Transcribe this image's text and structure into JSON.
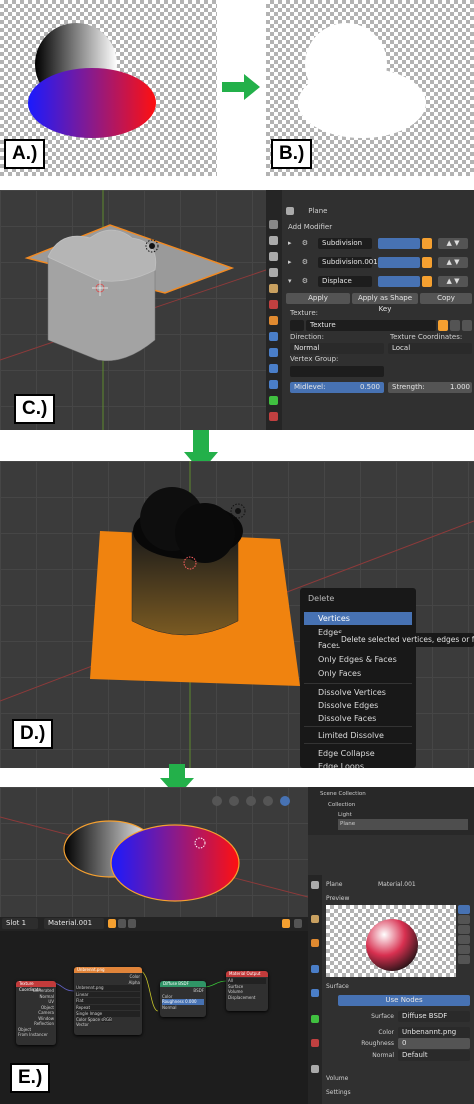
{
  "labels": {
    "a": "A.)",
    "b": "B.)",
    "c": "C.)",
    "d": "D.)",
    "e": "E.)"
  },
  "colors": {
    "arrow": "#23b04a",
    "blender_bg": "#303030",
    "select_orange": "#f5a030",
    "highlight_blue": "#4772b3",
    "node_image": "#e0843a",
    "node_mapping": "#2f9466",
    "node_output": "#c23b3b"
  },
  "modifier_panel": {
    "object_name": "Plane",
    "add_modifier": "Add Modifier",
    "modifiers": [
      "Subdivision",
      "Subdivision.001",
      "Displace"
    ],
    "apply": "Apply",
    "apply_shape": "Apply as Shape Key",
    "copy": "Copy",
    "texture_label": "Texture:",
    "texture_value": "Texture",
    "direction_label": "Direction:",
    "direction_value": "Normal",
    "coords_label": "Texture Coordinates:",
    "coords_value": "Local",
    "vgroup_label": "Vertex Group:",
    "midlevel_label": "Midlevel:",
    "midlevel_value": "0.500",
    "strength_label": "Strength:",
    "strength_value": "1.000"
  },
  "delete_menu": {
    "title": "Delete",
    "items": [
      "Vertices",
      "Edges",
      "Faces",
      "Only Edges & Faces",
      "Only Faces",
      "Dissolve Vertices",
      "Dissolve Edges",
      "Dissolve Faces",
      "Limited Dissolve",
      "Edge Collapse",
      "Edge Loops"
    ],
    "tooltip": "Delete selected vertices, edges or faces"
  },
  "node_editor": {
    "slot": "Slot 1",
    "material": "Material.001",
    "nodes": {
      "coords": {
        "title": "Texture Coordinate",
        "rows": [
          "Generated",
          "Normal",
          "UV",
          "Object",
          "Camera",
          "Window",
          "Reflection",
          "Object",
          "From Instancer"
        ]
      },
      "image": {
        "title": "Unbrennt.png",
        "rows": [
          "Color",
          "Alpha",
          "Unbrennt.png",
          "Linear",
          "Flat",
          "Repeat",
          "Single Image",
          "Color Space",
          "sRGB",
          "Vector"
        ]
      },
      "bsdf": {
        "title": "Diffuse BSDF",
        "rows": [
          "BSDF",
          "Color",
          "Roughness",
          "0.000",
          "Normal"
        ]
      },
      "output": {
        "title": "Material Output",
        "rows": [
          "All",
          "Surface",
          "Volume",
          "Displacement"
        ]
      }
    }
  },
  "outliner": {
    "items": [
      "Scene Collection",
      "Collection",
      "Light",
      "Plane"
    ]
  },
  "material_panel": {
    "object": "Plane",
    "material": "Material.001",
    "preview": "Preview",
    "surface": "Surface",
    "use_nodes": "Use Nodes",
    "surface_label": "Surface",
    "surface_value": "Diffuse BSDF",
    "color_label": "Color",
    "color_value": "Unbenannt.png",
    "roughness_label": "Roughness",
    "roughness_value": "0",
    "normal_label": "Normal",
    "normal_value": "Default",
    "volume": "Volume",
    "settings": "Settings"
  }
}
